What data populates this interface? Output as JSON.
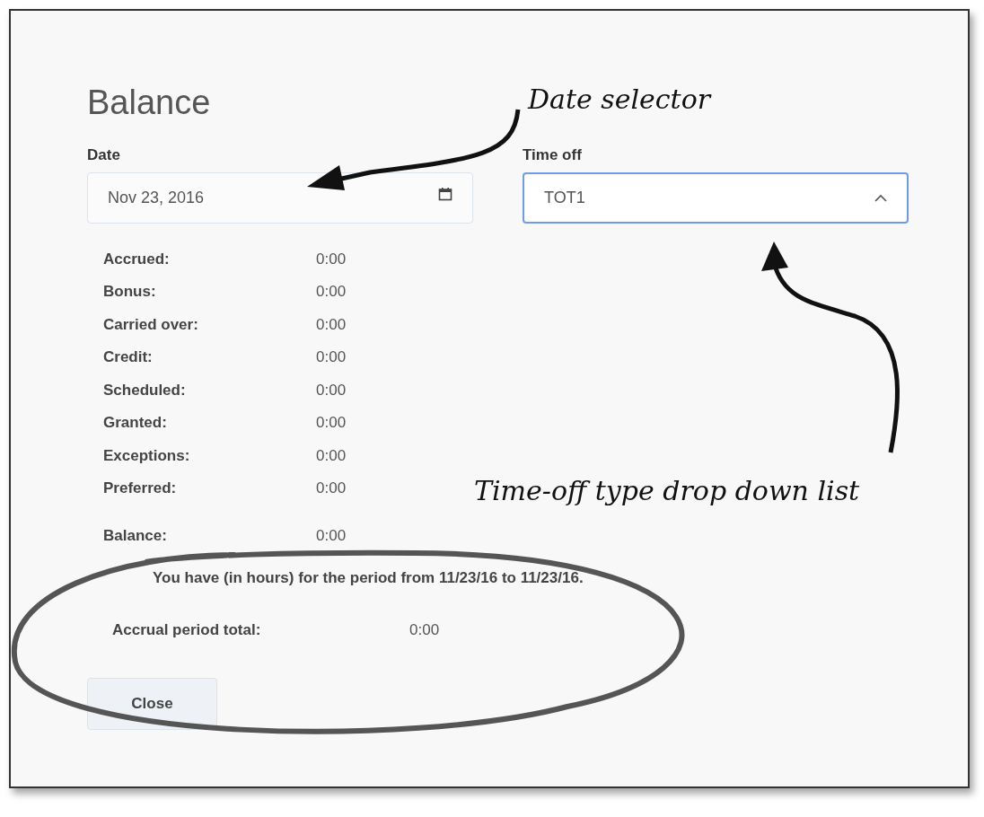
{
  "dialog": {
    "title": "Balance"
  },
  "date_field": {
    "label": "Date",
    "value": "Nov 23, 2016"
  },
  "time_off_field": {
    "label": "Time off",
    "value": "TOT1",
    "expanded": true
  },
  "rows": [
    {
      "label": "Accrued:",
      "value": "0:00"
    },
    {
      "label": "Bonus:",
      "value": "0:00"
    },
    {
      "label": "Carried over:",
      "value": "0:00"
    },
    {
      "label": "Credit:",
      "value": "0:00"
    },
    {
      "label": "Scheduled:",
      "value": "0:00"
    },
    {
      "label": "Granted:",
      "value": "0:00"
    },
    {
      "label": "Exceptions:",
      "value": "0:00"
    },
    {
      "label": "Preferred:",
      "value": "0:00"
    }
  ],
  "balance": {
    "label": "Balance:",
    "value": "0:00"
  },
  "period_note": "You have (in hours) for the period from 11/23/16 to 11/23/16.",
  "accrual_total": {
    "label": "Accrual period total:",
    "value": "0:00"
  },
  "close_button": "Close",
  "annotations": [
    {
      "text": "Date selector"
    },
    {
      "text": "Time-off type drop down list"
    }
  ]
}
